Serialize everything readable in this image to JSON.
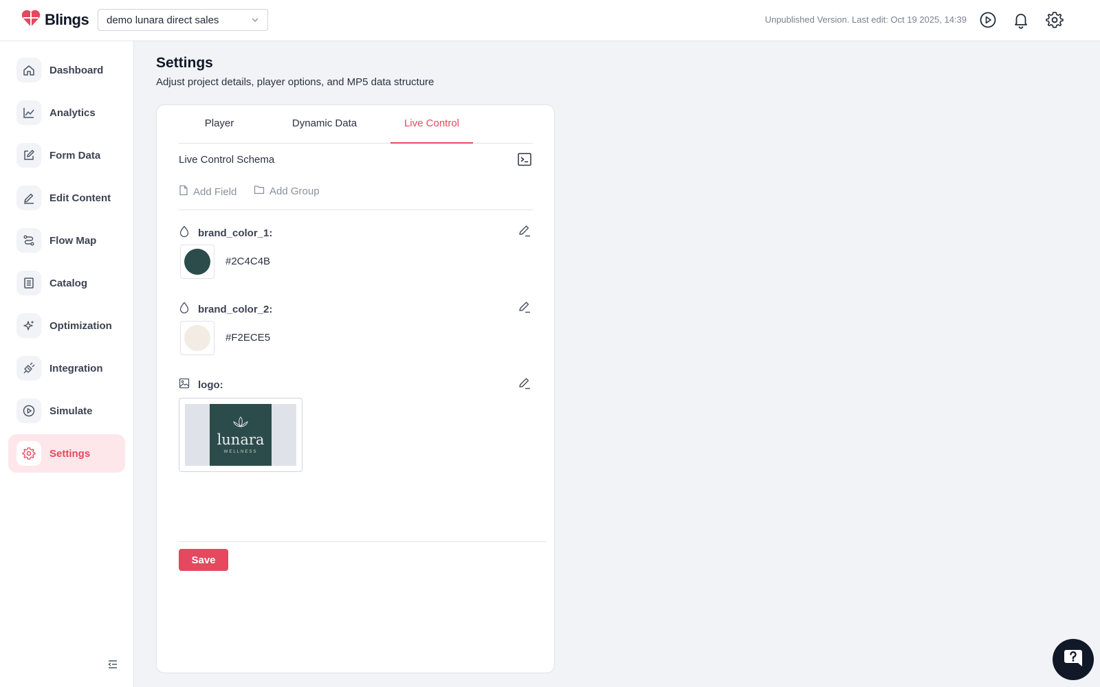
{
  "app": {
    "brand_name": "Blings",
    "project_name": "demo lunara direct sales",
    "status": "Unpublished Version. Last edit: Oct 19 2025, 14:39",
    "accent_color": "#e5485f"
  },
  "sidebar": {
    "items": [
      {
        "label": "Dashboard",
        "icon": "home-icon"
      },
      {
        "label": "Analytics",
        "icon": "chart-line-icon"
      },
      {
        "label": "Form Data",
        "icon": "edit-square-icon"
      },
      {
        "label": "Edit Content",
        "icon": "pencil-icon"
      },
      {
        "label": "Flow Map",
        "icon": "flow-icon"
      },
      {
        "label": "Catalog",
        "icon": "catalog-icon"
      },
      {
        "label": "Optimization",
        "icon": "sparkles-icon"
      },
      {
        "label": "Integration",
        "icon": "plug-icon"
      },
      {
        "label": "Simulate",
        "icon": "play-circle-icon"
      },
      {
        "label": "Settings",
        "icon": "gear-icon",
        "active": true
      }
    ]
  },
  "page": {
    "title": "Settings",
    "subtitle": "Adjust project details, player options, and MP5 data structure"
  },
  "tabs": [
    {
      "label": "Player"
    },
    {
      "label": "Dynamic Data"
    },
    {
      "label": "Live Control",
      "active": true
    }
  ],
  "schema": {
    "title": "Live Control Schema",
    "add_field_label": "Add Field",
    "add_group_label": "Add Group",
    "fields": [
      {
        "name": "brand_color_1:",
        "type": "color",
        "value": "#2C4C4B",
        "swatch": "#2c4c4b"
      },
      {
        "name": "brand_color_2:",
        "type": "color",
        "value": "#F2ECE5",
        "swatch": "#f2ece5"
      },
      {
        "name": "logo:",
        "type": "image"
      }
    ],
    "logo": {
      "wordmark": "lunara",
      "tagline": "WELLNESS",
      "bg_color": "#2c4c4b"
    },
    "save_label": "Save"
  }
}
